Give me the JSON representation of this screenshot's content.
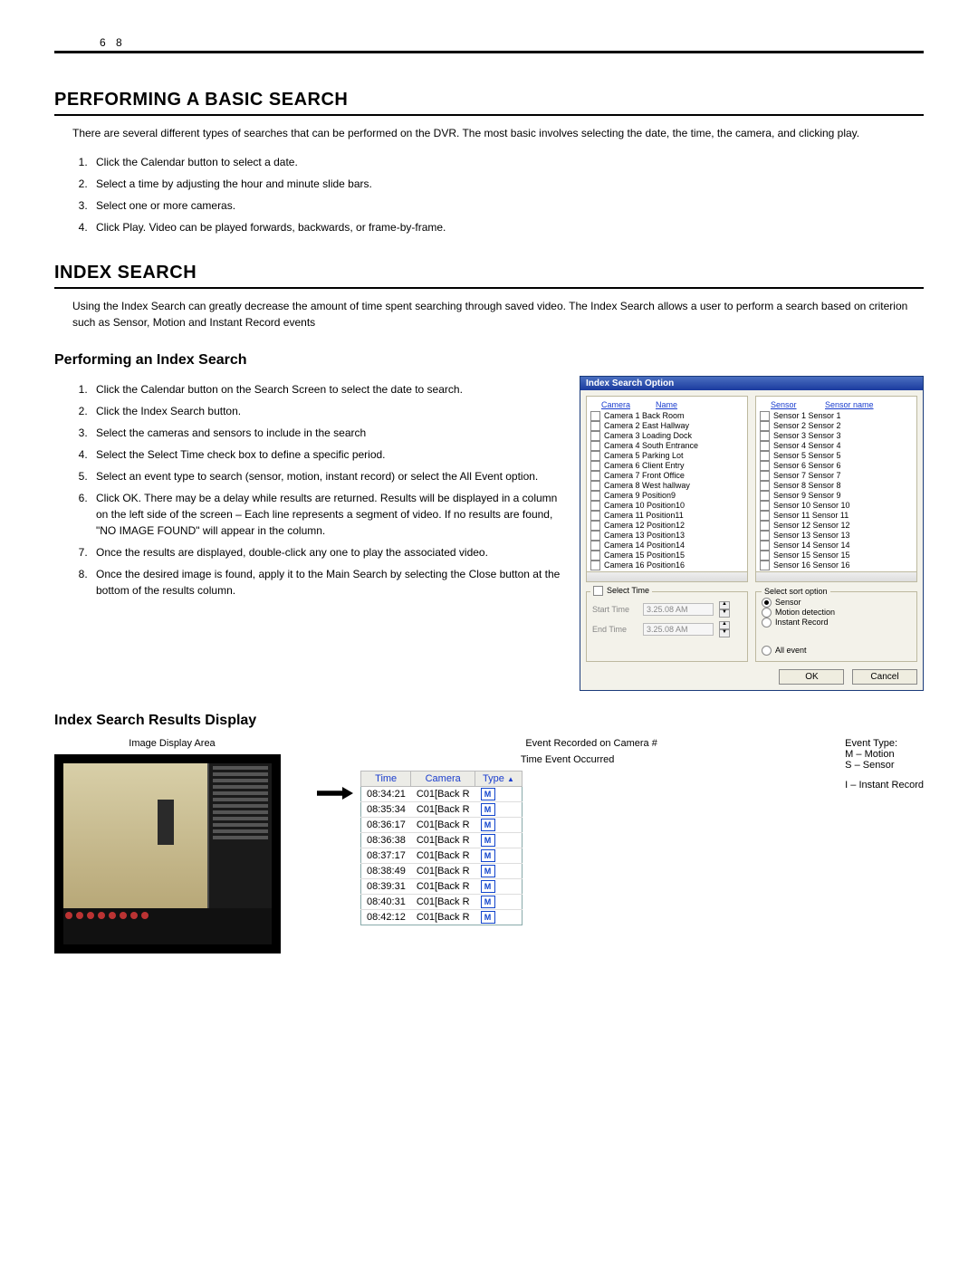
{
  "page_number": "6 8",
  "section1": {
    "heading": "PERFORMING A BASIC SEARCH",
    "intro": "There are several different types of searches that can be performed on the DVR. The most basic involves selecting the date, the time, the camera, and clicking play.",
    "steps": [
      "Click the Calendar button to select a date.",
      "Select a time by adjusting the hour and minute slide bars.",
      "Select one or more cameras.",
      "Click Play. Video can be played forwards, backwards, or frame-by-frame."
    ]
  },
  "section2": {
    "heading": "INDEX SEARCH",
    "intro": "Using the Index Search can greatly decrease the amount of time spent searching through saved video. The Index Search allows a user to perform a search based on criterion such as Sensor, Motion and Instant Record events",
    "subheading": "Performing an Index Search",
    "steps": [
      "Click the Calendar button on the Search Screen to select the date to search.",
      "Click the Index Search button.",
      "Select the cameras and sensors to include in the search",
      "Select the Select Time check box to define a specific period.",
      "Select an event type to search (sensor, motion, instant record) or select the All Event option.",
      "Click OK.  There may be a delay while results are returned.  Results will be displayed in a column on the left side of the screen – Each line represents a segment of video.  If no results are found, \"NO IMAGE FOUND\" will appear in the column.",
      "Once the results are displayed, double-click any one to play the associated video.",
      "Once the desired image is found, apply it to the Main Search by selecting the Close button at the bottom of the results column."
    ]
  },
  "dialog": {
    "title": "Index Search Option",
    "camera_col": "Camera",
    "name_col": "Name",
    "sensor_col": "Sensor",
    "sensor_name_col": "Sensor name",
    "cameras": [
      "Camera 1  Back Room",
      "Camera 2  East Hallway",
      "Camera 3  Loading Dock",
      "Camera 4  South Entrance",
      "Camera 5  Parking Lot",
      "Camera 6  Client Entry",
      "Camera 7  Front Office",
      "Camera 8  West hallway",
      "Camera 9  Position9",
      "Camera 10 Position10",
      "Camera 11 Position11",
      "Camera 12 Position12",
      "Camera 13 Position13",
      "Camera 14 Position14",
      "Camera 15 Position15",
      "Camera 16 Position16"
    ],
    "sensors": [
      "Sensor 1  Sensor 1",
      "Sensor 2  Sensor 2",
      "Sensor 3  Sensor 3",
      "Sensor 4  Sensor 4",
      "Sensor 5  Sensor 5",
      "Sensor 6  Sensor 6",
      "Sensor 7  Sensor 7",
      "Sensor 8  Sensor 8",
      "Sensor 9  Sensor 9",
      "Sensor 10  Sensor 10",
      "Sensor 11  Sensor 11",
      "Sensor 12  Sensor 12",
      "Sensor 13  Sensor 13",
      "Sensor 14  Sensor 14",
      "Sensor 15  Sensor 15",
      "Sensor 16  Sensor 16"
    ],
    "select_time_label": "Select Time",
    "start_label": "Start Time",
    "end_label": "End Time",
    "start_value": "3.25.08 AM",
    "end_value": "3.25.08 AM",
    "sort_label": "Select sort option",
    "opt_sensor": "Sensor",
    "opt_motion": "Motion detection",
    "opt_instant": "Instant Record",
    "opt_all": "All event",
    "ok": "OK",
    "cancel": "Cancel"
  },
  "section3": {
    "subheading": "Index Search Results Display",
    "callouts": {
      "image_area": "Image Display Area",
      "event_cam": "Event Recorded on Camera #",
      "time_event": "Time Event Occurred",
      "event_type_heading": "Event Type:",
      "m": "M – Motion",
      "s": "S – Sensor",
      "i": "I – Instant Record"
    },
    "table": {
      "headers": [
        "Time",
        "Camera",
        "Type"
      ],
      "rows": [
        [
          "08:34:21",
          "C01[Back R",
          "M"
        ],
        [
          "08:35:34",
          "C01[Back R",
          "M"
        ],
        [
          "08:36:17",
          "C01[Back R",
          "M"
        ],
        [
          "08:36:38",
          "C01[Back R",
          "M"
        ],
        [
          "08:37:17",
          "C01[Back R",
          "M"
        ],
        [
          "08:38:49",
          "C01[Back R",
          "M"
        ],
        [
          "08:39:31",
          "C01[Back R",
          "M"
        ],
        [
          "08:40:31",
          "C01[Back R",
          "M"
        ],
        [
          "08:42:12",
          "C01[Back R",
          "M"
        ]
      ]
    }
  }
}
